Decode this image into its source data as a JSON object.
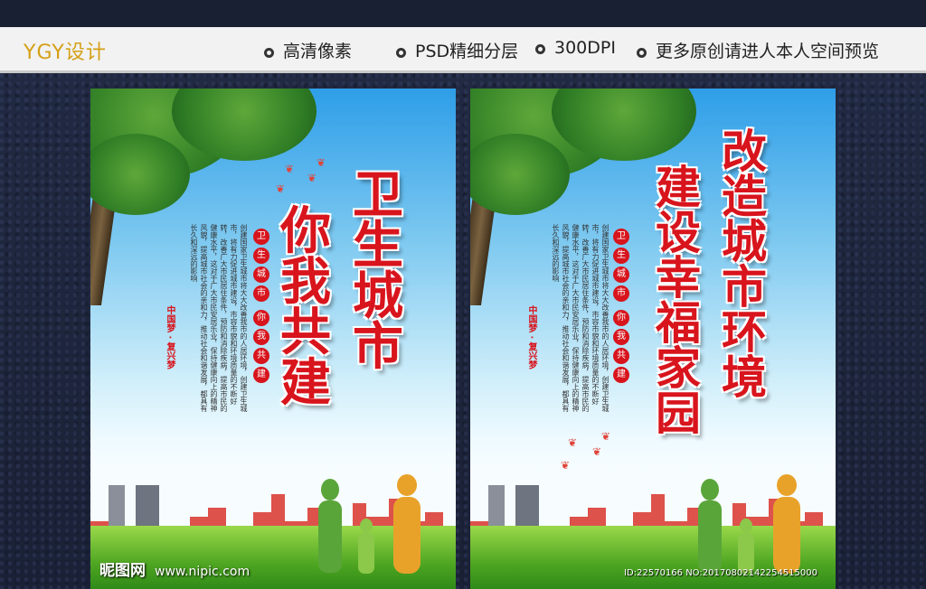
{
  "header": {
    "logo": "YGY设计",
    "features": [
      "高清像素",
      "PSD精细分层",
      "300DPI",
      "更多原创请进人本人空间预览"
    ]
  },
  "posters": [
    {
      "title_col1": [
        "卫",
        "生",
        "城",
        "市"
      ],
      "title_col2": [
        "你",
        "我",
        "共",
        "建"
      ],
      "slogan_a": [
        "卫",
        "生",
        "城",
        "市"
      ],
      "slogan_b": [
        "你",
        "我",
        "共",
        "建"
      ],
      "china_dream": "中国梦 · 复兴梦",
      "body_text": "创建国家卫生城市将大大改善我市的人居环境，创建卫生城市，将有力促进城市建设，市容市貌和环境质量的不断好转，改善广大市民居住条件，预防和消除疾病，提高市民的健康水平，这对于广大市民安居乐业，保持健康向上的精神风貌，提高城市社会的亲和力，推动社会和谐发展，都具有长久和深远的影响"
    },
    {
      "title_col1": [
        "改",
        "造",
        "城",
        "市",
        "环",
        "境"
      ],
      "title_col2": [
        "建",
        "设",
        "幸",
        "福",
        "家",
        "园"
      ],
      "slogan_a": [
        "卫",
        "生",
        "城",
        "市"
      ],
      "slogan_b": [
        "你",
        "我",
        "共",
        "建"
      ],
      "china_dream": "中国梦 · 复兴梦",
      "body_text": "创建国家卫生城市将大大改善我市的人居环境，创建卫生城市，将有力促进城市建设，市容市貌和环境质量的不断好转，改善广大市民居住条件，预防和消除疾病，提高市民的健康水平，这对于广大市民安居乐业，保持健康向上的精神风貌，提高城市社会的亲和力，推动社会和谐发展，都具有长久和深远的影响"
    }
  ],
  "watermark": {
    "site": "昵图网",
    "url": "www.nipic.com"
  },
  "image_id": "ID:22570166 NO:20170802142254515000",
  "colors": {
    "title_red": "#d8141c",
    "logo_gold": "#d4a017",
    "sky": "#2e9ee8"
  }
}
